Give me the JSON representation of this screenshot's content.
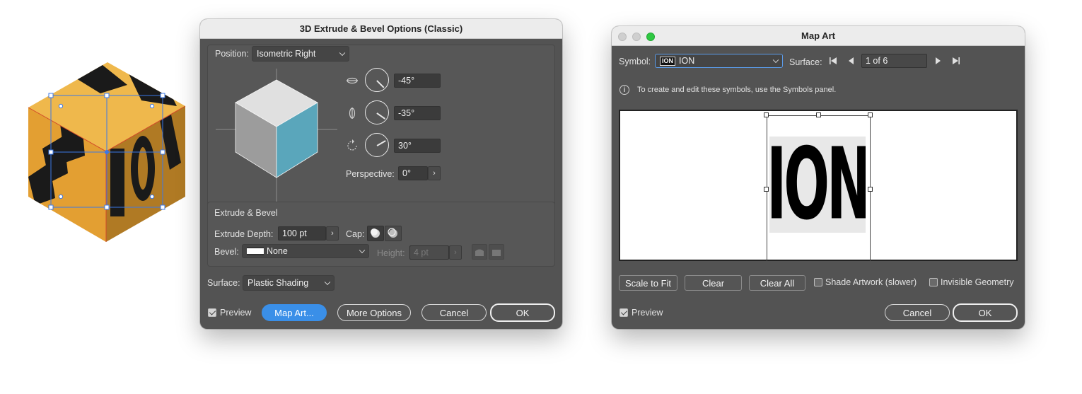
{
  "artwork": {
    "letters": "DIMENSION",
    "colors": {
      "face": "#e39f32",
      "dark": "#1a1a1a",
      "selection": "#3b78e7"
    }
  },
  "extrude_dialog": {
    "title": "3D Extrude & Bevel Options (Classic)",
    "position_label": "Position:",
    "position_value": "Isometric Right",
    "rotation_x": "-45°",
    "rotation_y": "-35°",
    "rotation_z": "30°",
    "perspective_label": "Perspective:",
    "perspective_value": "0°",
    "section_title": "Extrude & Bevel",
    "extrude_depth_label": "Extrude Depth:",
    "extrude_depth_value": "100 pt",
    "cap_label": "Cap:",
    "bevel_label": "Bevel:",
    "bevel_value": "None",
    "height_label": "Height:",
    "height_value": "4 pt",
    "surface_label": "Surface:",
    "surface_value": "Plastic Shading",
    "preview_label": "Preview",
    "buttons": {
      "map_art": "Map Art...",
      "more_options": "More Options",
      "cancel": "Cancel",
      "ok": "OK"
    },
    "cube_colors": {
      "top": "#e0e0e0",
      "left": "#9c9c9c",
      "right": "#5aa6bb"
    }
  },
  "map_art_dialog": {
    "title": "Map Art",
    "symbol_label": "Symbol:",
    "symbol_value": "ION",
    "symbol_thumb": "ION",
    "surface_label": "Surface:",
    "surface_value": "1 of 6",
    "info_text": "To create and edit these symbols, use the Symbols panel.",
    "preview_art_text": "ION",
    "buttons": {
      "scale_to_fit": "Scale to Fit",
      "clear": "Clear",
      "clear_all": "Clear All",
      "cancel": "Cancel",
      "ok": "OK"
    },
    "shade_artwork_label": "Shade Artwork (slower)",
    "invisible_geometry_label": "Invisible Geometry",
    "preview_label": "Preview"
  }
}
